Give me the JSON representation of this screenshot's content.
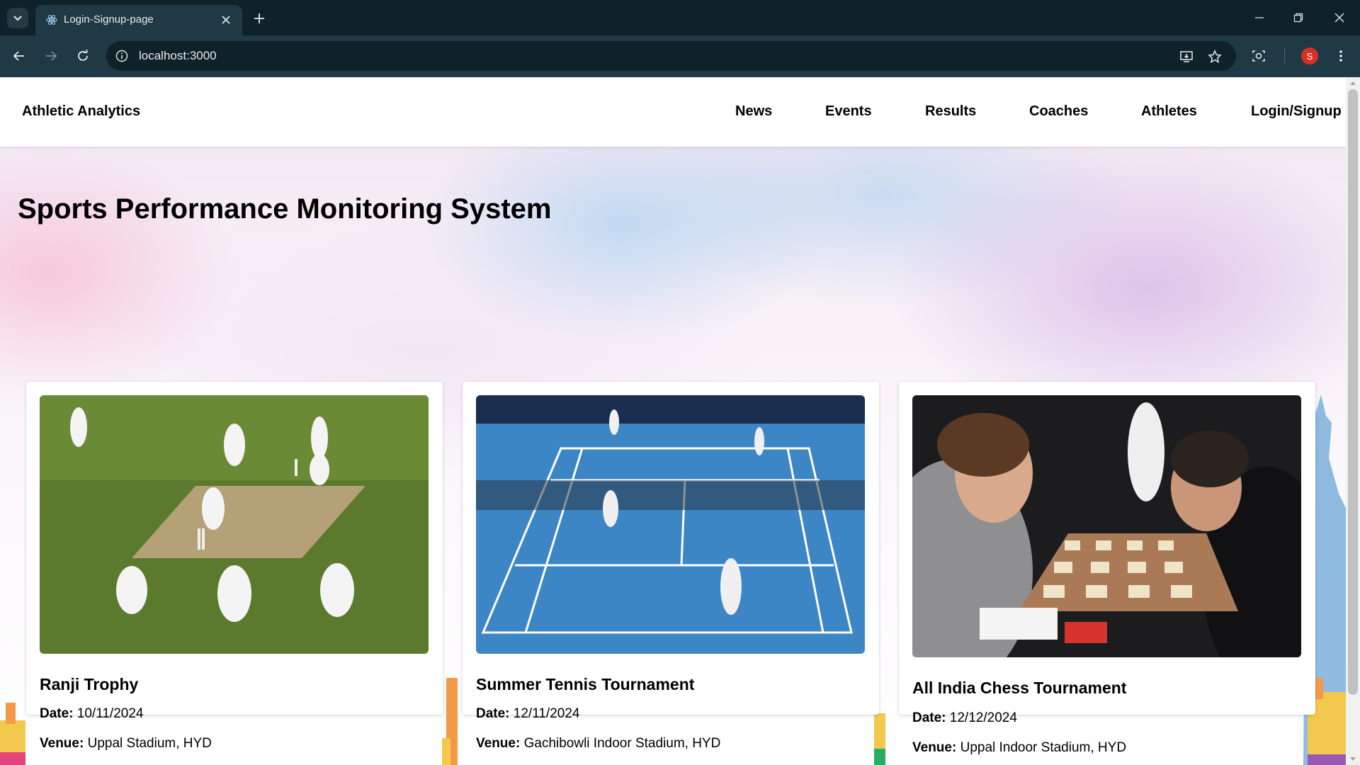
{
  "browser": {
    "tab_title": "Login-Signup-page",
    "url": "localhost:3000",
    "profile_initial": "S",
    "icons": [
      "tab-search-icon",
      "react-favicon-icon",
      "close-icon",
      "plus-icon",
      "minimize-icon",
      "restore-icon",
      "close-window-icon",
      "back-icon",
      "forward-icon",
      "reload-icon",
      "info-icon",
      "install-app-icon",
      "star-icon",
      "screenshot-icon",
      "more-menu-icon"
    ]
  },
  "header": {
    "brand": "Athletic Analytics",
    "nav": [
      "News",
      "Events",
      "Results",
      "Coaches",
      "Athletes",
      "Login/Signup"
    ]
  },
  "hero": {
    "title": "Sports Performance Monitoring System"
  },
  "labels": {
    "date": "Date:",
    "venue": "Venue:"
  },
  "events": [
    {
      "title": "Ranji Trophy",
      "date": "10/11/2024",
      "venue": "Uppal Stadium, HYD",
      "image": "cricket-match-photo"
    },
    {
      "title": "Summer Tennis Tournament",
      "date": "12/11/2024",
      "venue": "Gachibowli Indoor Stadium, HYD",
      "image": "tennis-match-photo"
    },
    {
      "title": "All India Chess Tournament",
      "date": "12/12/2024",
      "venue": "Uppal Indoor Stadium, HYD",
      "image": "chess-match-photo"
    }
  ],
  "colors": {
    "chrome_dark": "#0f2129",
    "chrome_toolbar": "#1f3a44",
    "avatar": "#d93025"
  }
}
